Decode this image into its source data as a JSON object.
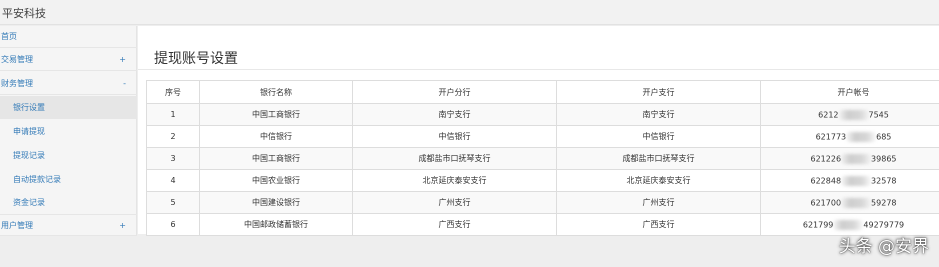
{
  "app": {
    "title": "平安科技"
  },
  "sidebar": {
    "items": [
      {
        "label": "首页"
      },
      {
        "label": "交易管理",
        "expander": "+"
      },
      {
        "label": "财务管理",
        "expander": "-"
      },
      {
        "label": "用户管理",
        "expander": "+"
      }
    ],
    "sub_items": [
      {
        "label": "银行设置",
        "active": true
      },
      {
        "label": "申请提现"
      },
      {
        "label": "提现记录"
      },
      {
        "label": "自动提款记录"
      },
      {
        "label": "资金记录"
      }
    ]
  },
  "main": {
    "title": "提现账号设置",
    "table": {
      "columns": [
        "序号",
        "银行名称",
        "开户分行",
        "开户支行",
        "开户帐号"
      ],
      "rows": [
        {
          "no": "1",
          "bank": "中国工商银行",
          "branch": "南宁支行",
          "subbranch": "南宁支行",
          "acct_start": "6212",
          "acct_end": "7545"
        },
        {
          "no": "2",
          "bank": "中信银行",
          "branch": "中信银行",
          "subbranch": "中信银行",
          "acct_start": "621773",
          "acct_end": "685"
        },
        {
          "no": "3",
          "bank": "中国工商银行",
          "branch": "成都盐市口抚琴支行",
          "subbranch": "成都盐市口抚琴支行",
          "acct_start": "621226",
          "acct_end": "39865"
        },
        {
          "no": "4",
          "bank": "中国农业银行",
          "branch": "北京延庆泰安支行",
          "subbranch": "北京延庆泰安支行",
          "acct_start": "622848",
          "acct_end": "32578"
        },
        {
          "no": "5",
          "bank": "中国建设银行",
          "branch": "广州支行",
          "subbranch": "广州支行",
          "acct_start": "621700",
          "acct_end": "59278"
        },
        {
          "no": "6",
          "bank": "中国邮政储蓄银行",
          "branch": "广西支行",
          "subbranch": "广西支行",
          "acct_start": "621799",
          "acct_end": "49279779"
        }
      ]
    }
  },
  "watermark": "头条 @安界"
}
